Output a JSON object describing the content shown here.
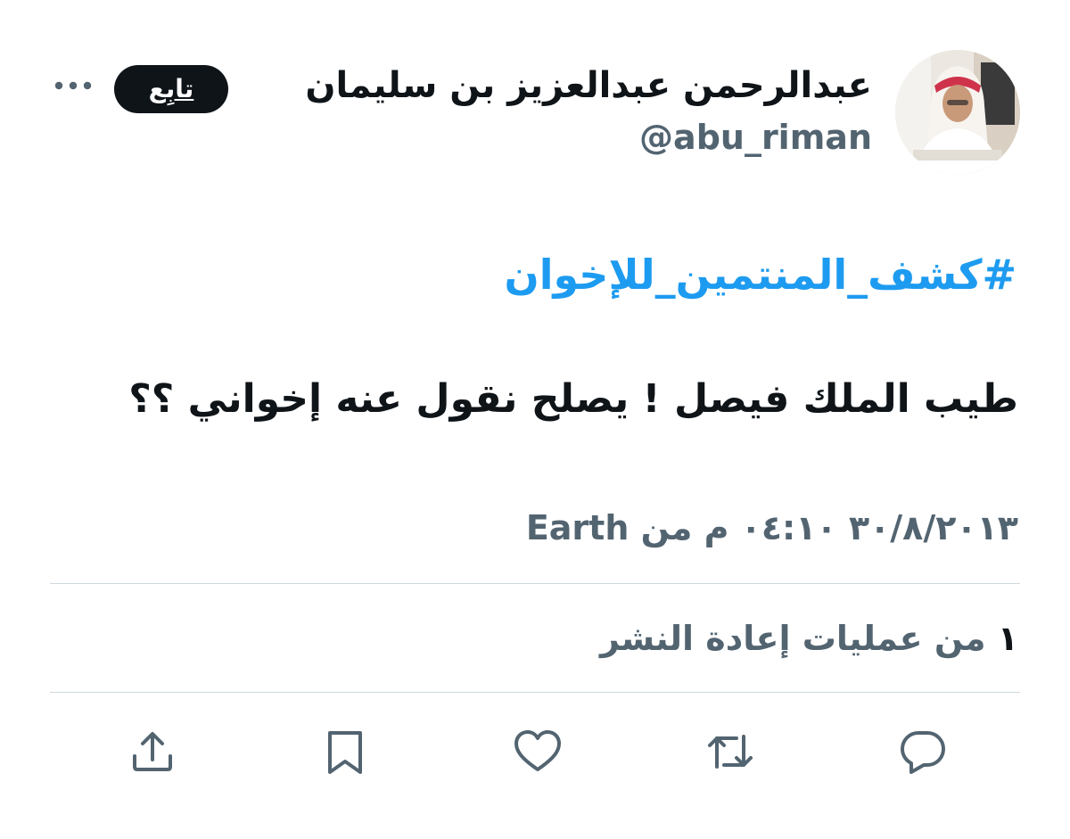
{
  "user": {
    "display_name": "عبدالرحمن عبدالعزيز بن سليمان",
    "handle": "@abu_riman",
    "follow_label": "تابِع"
  },
  "tweet": {
    "hashtag": "#كشف_المنتمين_للإخوان",
    "text": "طيب الملك فيصل ! يصلح نقول عنه إخواني ؟؟",
    "meta": "٣٠/٨/٢٠١٣ ٠٤:١٠ م من Earth"
  },
  "stats": {
    "retweet_count": "١",
    "retweet_label": "من عمليات إعادة النشر"
  },
  "icons": {
    "more": "more-horizontal-icon",
    "reply": "reply-icon",
    "retweet": "retweet-icon",
    "like": "heart-icon",
    "bookmark": "bookmark-icon",
    "share": "share-icon"
  },
  "colors": {
    "text": "#0f1419",
    "secondary": "#536471",
    "hashtag": "#1d9bf0",
    "divider": "#cfd9de",
    "follow_bg": "#0f1419"
  }
}
